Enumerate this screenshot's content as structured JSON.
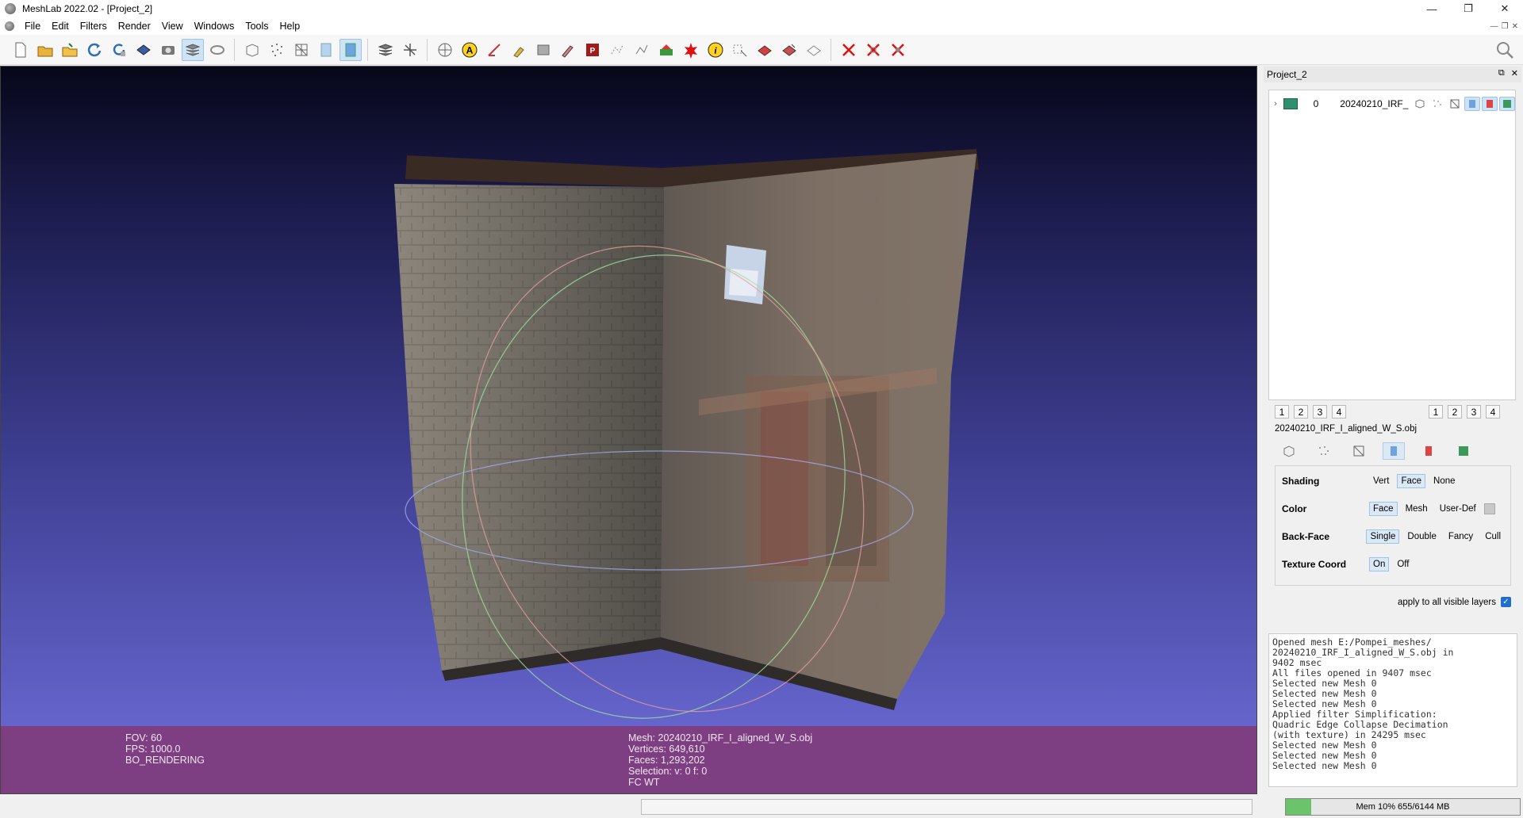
{
  "window": {
    "title": "MeshLab 2022.02 - [Project_2]",
    "controls": [
      "—",
      "❐",
      "✕"
    ]
  },
  "menu": {
    "items": [
      "File",
      "Edit",
      "Filters",
      "Render",
      "View",
      "Windows",
      "Tools",
      "Help"
    ]
  },
  "toolbar": {
    "groups": [
      [
        "new-file-icon",
        "open-icon",
        "open-project-icon",
        "reload-icon",
        "reload-all-icon",
        "save-icon",
        "snapshot-icon",
        "layers-icon",
        "bbox-icon"
      ],
      [
        "box-icon",
        "points-icon",
        "wireframe-icon",
        "flat-icon",
        "smooth-icon"
      ],
      [
        "light-icon",
        "axes-icon"
      ],
      [
        "globe-icon",
        "annotate-icon",
        "measure-icon",
        "pick-icon",
        "mesh-tool-icon",
        "paint-icon",
        "select-face-icon",
        "select-vertex-icon",
        "select-connected-icon",
        "color-icon",
        "georef-icon",
        "info-icon",
        "select-region-icon",
        "raster-icon",
        "align-icon",
        "pick-points-icon"
      ],
      [
        "delete-face-icon",
        "delete-vertex-icon",
        "delete-selection-icon"
      ]
    ]
  },
  "viewport": {
    "info_left": [
      "FOV: 60",
      "FPS:  1000.0",
      "BO_RENDERING"
    ],
    "info_right": [
      "Mesh: 20240210_IRF_I_aligned_W_S.obj",
      "Vertices: 649,610",
      "Faces: 1,293,202",
      "Selection: v: 0 f: 0",
      "FC WT"
    ]
  },
  "dock": {
    "title": "Project_2",
    "layer": {
      "id": "0",
      "name": "20240210_IRF_..."
    },
    "view_numbers_left": [
      "1",
      "2",
      "3",
      "4"
    ],
    "view_numbers_right": [
      "1",
      "2",
      "3",
      "4"
    ],
    "mesh_name": "20240210_IRF_I_aligned_W_S.obj",
    "render_options": {
      "shading": {
        "label": "Shading",
        "options": [
          "Vert",
          "Face",
          "None"
        ],
        "selected": "Face"
      },
      "color": {
        "label": "Color",
        "options": [
          "Face",
          "Mesh",
          "User-Def"
        ],
        "selected": "Face"
      },
      "backface": {
        "label": "Back-Face",
        "options": [
          "Single",
          "Double",
          "Fancy",
          "Cull"
        ],
        "selected": "Single"
      },
      "texcoord": {
        "label": "Texture Coord",
        "options": [
          "On",
          "Off"
        ],
        "selected": "On"
      }
    },
    "apply_all": "apply to all visible layers",
    "log": "Opened mesh E:/Pompei_meshes/\n20240210_IRF_I_aligned_W_S.obj in\n9402 msec\nAll files opened in 9407 msec\nSelected new Mesh 0\nSelected new Mesh 0\nSelected new Mesh 0\nApplied filter Simplification:\nQuadric Edge Collapse Decimation\n(with texture) in 24295 msec\nSelected new Mesh 0\nSelected new Mesh 0\nSelected new Mesh 0"
  },
  "status": {
    "memory_label": "Mem 10% 655/6144 MB",
    "memory_fraction": 0.107
  }
}
